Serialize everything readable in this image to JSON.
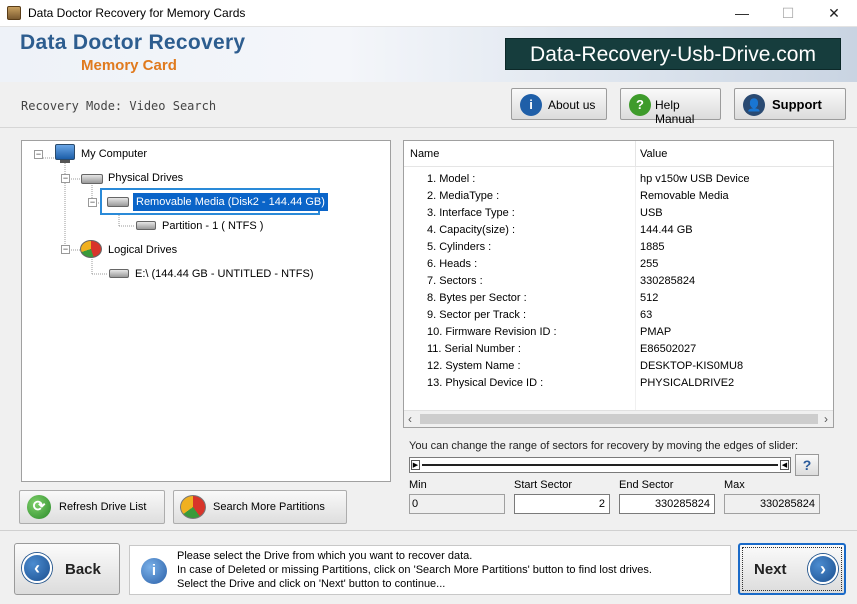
{
  "window": {
    "title": "Data Doctor Recovery for Memory Cards",
    "controls": {
      "minimize": "—",
      "maximize": "☐",
      "close": "✕"
    }
  },
  "header": {
    "brand_line1": "Data Doctor Recovery",
    "brand_line2": "Memory Card",
    "website": "Data-Recovery-Usb-Drive.com"
  },
  "toolbar": {
    "mode_label": "Recovery Mode: Video Search",
    "about_label": "About us",
    "help_label": "Help Manual",
    "support_label": "Support"
  },
  "tree": {
    "root": "My Computer",
    "physical": "Physical Drives",
    "removable": "Removable Media (Disk2 - 144.44 GB)",
    "partition": "Partition - 1 ( NTFS )",
    "logical": "Logical Drives",
    "logical_drive": "E:\\ (144.44 GB - UNTITLED - NTFS)"
  },
  "details": {
    "columns": {
      "name": "Name",
      "value": "Value"
    },
    "rows": [
      {
        "name": "1. Model :",
        "value": "hp v150w USB Device"
      },
      {
        "name": "2. MediaType :",
        "value": "Removable Media"
      },
      {
        "name": "3. Interface Type :",
        "value": "USB"
      },
      {
        "name": "4. Capacity(size) :",
        "value": "144.44 GB"
      },
      {
        "name": "5. Cylinders :",
        "value": "1885"
      },
      {
        "name": "6. Heads :",
        "value": "255"
      },
      {
        "name": "7. Sectors :",
        "value": "330285824"
      },
      {
        "name": "8. Bytes per Sector :",
        "value": "512"
      },
      {
        "name": "9. Sector per Track :",
        "value": "63"
      },
      {
        "name": "10. Firmware Revision ID :",
        "value": "PMAP"
      },
      {
        "name": "11. Serial Number :",
        "value": "E86502027"
      },
      {
        "name": "12. System Name :",
        "value": "DESKTOP-KIS0MU8"
      },
      {
        "name": "13. Physical Device ID :",
        "value": "PHYSICALDRIVE2"
      }
    ]
  },
  "range": {
    "hint": "You can change the range of sectors for recovery by moving the edges of slider:",
    "min_label": "Min",
    "start_label": "Start Sector",
    "end_label": "End Sector",
    "max_label": "Max",
    "min_value": "0",
    "start_value": "2",
    "end_value": "330285824",
    "max_value": "330285824",
    "help_glyph": "?"
  },
  "left_buttons": {
    "refresh": "Refresh Drive List",
    "search_more": "Search More Partitions"
  },
  "bottom": {
    "back_label": "Back",
    "next_label": "Next",
    "message_lines": [
      "Please select the Drive from which you want to recover data.",
      "In case of Deleted or missing Partitions, click on 'Search More Partitions' button to find lost drives.",
      "Select the Drive and click on 'Next' button to continue..."
    ]
  },
  "colors": {
    "brand_blue": "#2d5d8f",
    "brand_orange": "#e07a1e",
    "site_bg": "#163d3d",
    "selection": "#0a64c8"
  }
}
